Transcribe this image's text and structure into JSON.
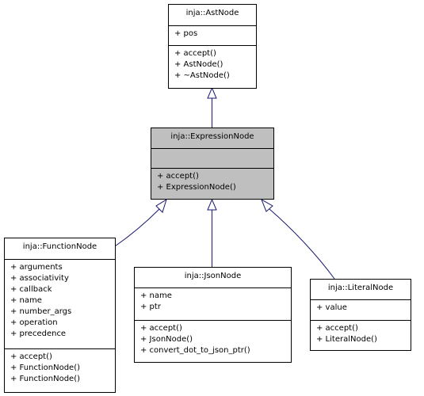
{
  "classes": {
    "ast_node": {
      "name": "inja::AstNode",
      "attributes": [
        "+ pos"
      ],
      "methods": [
        "+ accept()",
        "+ AstNode()",
        "+ ~AstNode()"
      ]
    },
    "expression_node": {
      "name": "inja::ExpressionNode",
      "attributes": [],
      "methods": [
        "+ accept()",
        "+ ExpressionNode()"
      ],
      "highlighted": true
    },
    "function_node": {
      "name": "inja::FunctionNode",
      "attributes": [
        "+ arguments",
        "+ associativity",
        "+ callback",
        "+ name",
        "+ number_args",
        "+ operation",
        "+ precedence"
      ],
      "methods": [
        "+ accept()",
        "+ FunctionNode()",
        "+ FunctionNode()"
      ]
    },
    "json_node": {
      "name": "inja::JsonNode",
      "attributes": [
        "+ name",
        "+ ptr"
      ],
      "methods": [
        "+ accept()",
        "+ JsonNode()",
        "+ convert_dot_to_json_ptr()"
      ]
    },
    "literal_node": {
      "name": "inja::LiteralNode",
      "attributes": [
        "+ value"
      ],
      "methods": [
        "+ accept()",
        "+ LiteralNode()"
      ]
    }
  },
  "edges": [
    {
      "from": "inja::ExpressionNode",
      "to": "inja::AstNode",
      "type": "inheritance"
    },
    {
      "from": "inja::FunctionNode",
      "to": "inja::ExpressionNode",
      "type": "inheritance"
    },
    {
      "from": "inja::JsonNode",
      "to": "inja::ExpressionNode",
      "type": "inheritance"
    },
    {
      "from": "inja::LiteralNode",
      "to": "inja::ExpressionNode",
      "type": "inheritance"
    }
  ],
  "colors": {
    "edge": "#191970",
    "highlight_fill": "#bfbfbf",
    "box_border": "#000000"
  }
}
